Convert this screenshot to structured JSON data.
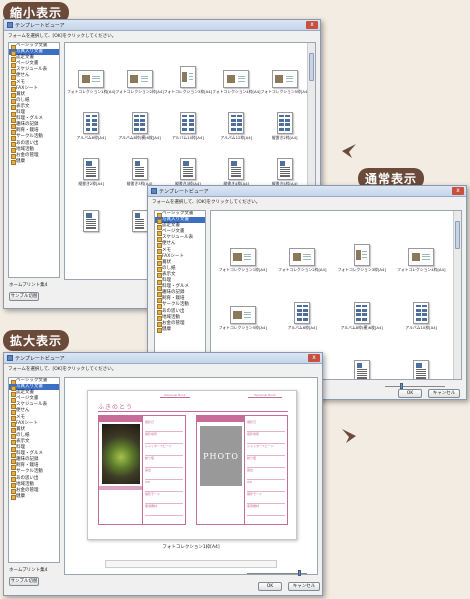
{
  "labels": {
    "thumbnail": "縮小表示",
    "normal": "通常表示",
    "enlarged": "拡大表示"
  },
  "window": {
    "title": "テンプレートビューア",
    "instruction": "フォームを選択して、[OK]をクリックしてください。",
    "close_glyph": "x",
    "ok_label": "OK",
    "cancel_label": "キャンセル",
    "sample_button": "サンプル切替",
    "template_set": "ホームプリント集4"
  },
  "categories": [
    "ベーシック文書",
    "写真入り文書",
    "認定文書",
    "ページ文書",
    "スケジュール表",
    "便せん",
    "メモ",
    "FAXシート",
    "賞状",
    "のし紙",
    "表示文",
    "料理",
    "料理・グルメ",
    "趣味の記録",
    "飼育・栽培",
    "サークル活動",
    "あの思い出",
    "地域活動",
    "お金の管理",
    "健康"
  ],
  "selected_category_index": 1,
  "thumbnail_window": {
    "items": [
      "フォトコレクション1枠[A4]",
      "フォトコレクション2枠[A4]",
      "フォトコレクション3枠[A4]",
      "フォトコレクション4枠[A4]",
      "フォトコレクション5枠[A4]",
      "アルバム6枠[A4]",
      "アルバム8枠(横)6枚[A4]",
      "アルバム10枠[A4]",
      "アルバム12枠[A4]",
      "縦書き2枠[A4]",
      "縦書き2枠[A4]",
      "縦書き3枠[A4]",
      "縦書き3枠[A4]",
      "縦書き4枠[A4]",
      "縦書き5枠[A4]",
      "",
      "",
      "",
      "",
      ""
    ]
  },
  "normal_window": {
    "items": [
      "フォトコレクション1枠[A4]",
      "フォトコレクション2枠[A4]",
      "フォトコレクション3枠[A4]",
      "フォトコレクション4枠[A4]",
      "フォトコレクション5枠[A4]",
      "アルバム6枠[A4]",
      "アルバム8枠(横)6枚[A4]",
      "アルバム10枠[A4]",
      "",
      "",
      "縦書き2枠[A4]",
      "縦書き3枠[A4]"
    ]
  },
  "enlarged_window": {
    "caption": "フォトコレクション1枠[A4]",
    "page_title": "ふきのとう",
    "photo_placeholder": "PHOTO",
    "header_tag_left": "Personal Book",
    "header_tag_right": "Personal Book",
    "field_labels_left": [
      "撮影日",
      "撮影場所",
      "シャッタースピード",
      "絞り値",
      "露出",
      "ISO",
      "撮影モード",
      "使用機材"
    ],
    "field_labels_right": [
      "撮影日",
      "撮影場所",
      "シャッタースピード",
      "絞り値",
      "露出",
      "ISO",
      "撮影モード",
      "使用機材"
    ]
  },
  "colors": {
    "accent_pink": "#c76b97",
    "selection_blue": "#3a6fc4",
    "badge_brown": "#6b4a3a",
    "arrow_brown": "#6b4a3a"
  }
}
